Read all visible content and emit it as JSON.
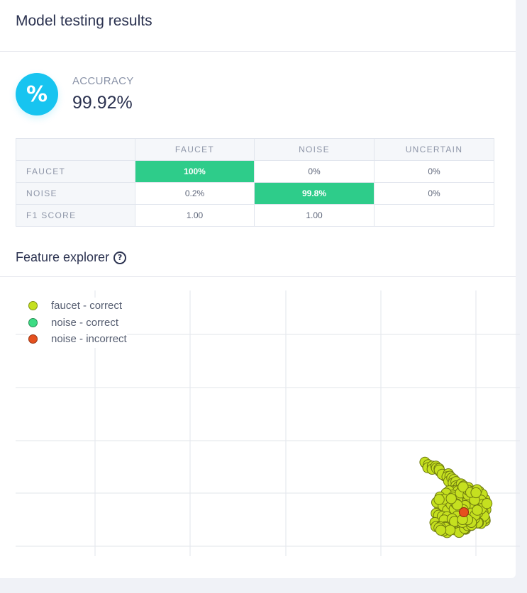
{
  "header": {
    "title": "Model testing results"
  },
  "accuracy": {
    "icon": "percent-icon",
    "icon_glyph": "%",
    "label": "ACCURACY",
    "value": "99.92%"
  },
  "confusion_matrix": {
    "columns": [
      "FAUCET",
      "NOISE",
      "UNCERTAIN"
    ],
    "rows": [
      {
        "label": "FAUCET",
        "cells": [
          "100%",
          "0%",
          "0%"
        ]
      },
      {
        "label": "NOISE",
        "cells": [
          "0.2%",
          "99.8%",
          "0%"
        ]
      },
      {
        "label": "F1 SCORE",
        "cells": [
          "1.00",
          "1.00",
          ""
        ]
      }
    ],
    "highlight_color": "#2ecc8a"
  },
  "feature_explorer": {
    "title": "Feature explorer",
    "help_icon": "help-circle-icon",
    "help_glyph": "?"
  },
  "chart_data": {
    "type": "scatter",
    "grid": true,
    "legend_position": "top-left",
    "series": [
      {
        "name": "faucet - correct",
        "color": "#c5e01f"
      },
      {
        "name": "noise - correct",
        "color": "#3ddc84"
      },
      {
        "name": "noise - incorrect",
        "color": "#e5501e"
      }
    ]
  }
}
